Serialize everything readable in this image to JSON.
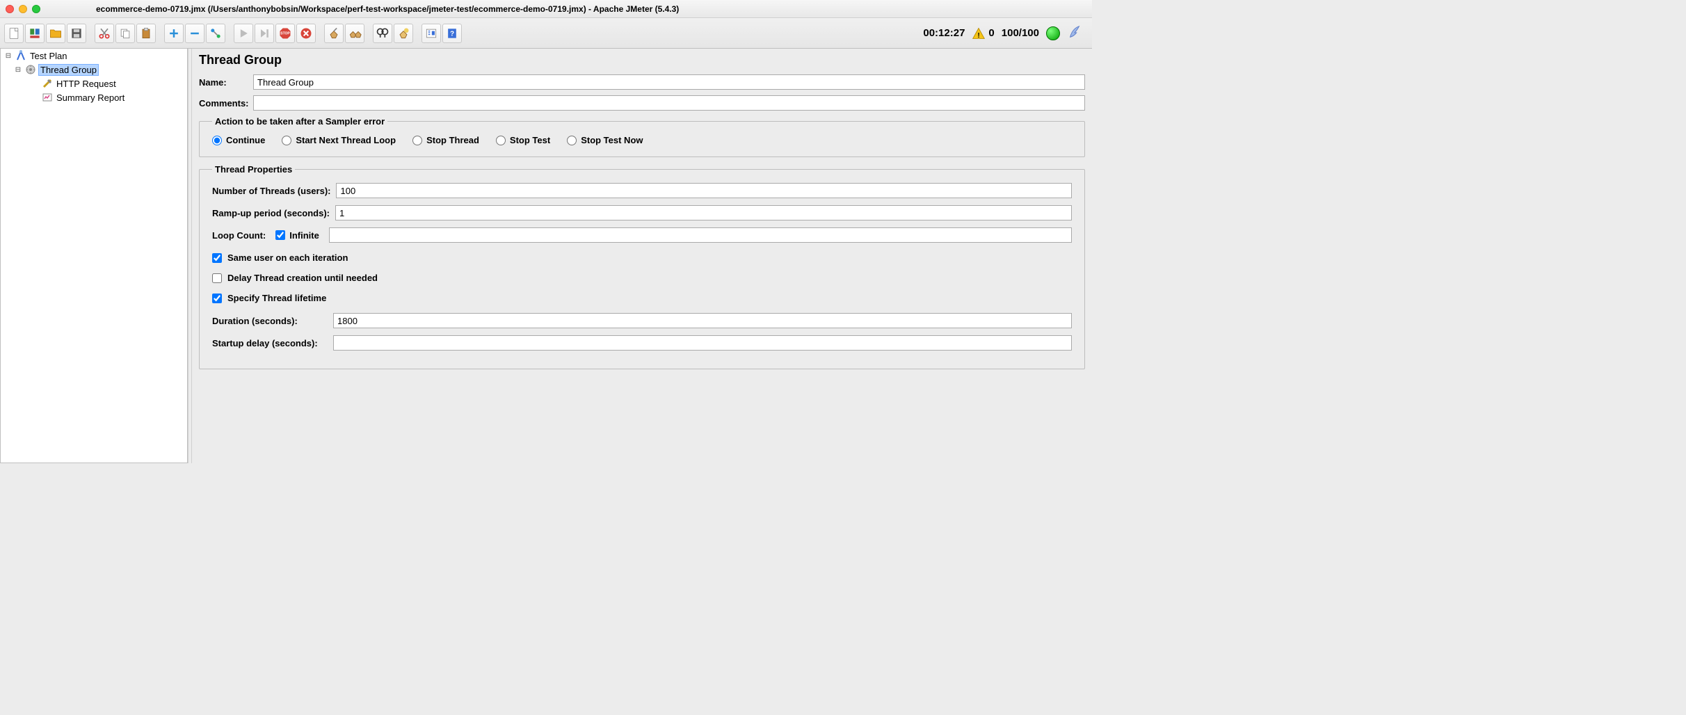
{
  "window": {
    "title": "ecommerce-demo-0719.jmx (/Users/anthonybobsin/Workspace/perf-test-workspace/jmeter-test/ecommerce-demo-0719.jmx) - Apache JMeter (5.4.3)"
  },
  "status": {
    "elapsed": "00:12:27",
    "error_count": "0",
    "thread_ratio": "100/100"
  },
  "tree": {
    "root": "Test Plan",
    "thread_group": "Thread Group",
    "http_request": "HTTP Request",
    "summary_report": "Summary Report"
  },
  "panel": {
    "heading": "Thread Group",
    "name_label": "Name:",
    "name_value": "Thread Group",
    "comments_label": "Comments:",
    "comments_value": "",
    "error_action_legend": "Action to be taken after a Sampler error",
    "error_actions": {
      "continue": "Continue",
      "start_next": "Start Next Thread Loop",
      "stop_thread": "Stop Thread",
      "stop_test": "Stop Test",
      "stop_test_now": "Stop Test Now"
    },
    "thread_props_legend": "Thread Properties",
    "num_threads_label": "Number of Threads (users):",
    "num_threads_value": "100",
    "ramp_up_label": "Ramp-up period (seconds):",
    "ramp_up_value": "1",
    "loop_count_label": "Loop Count:",
    "infinite_label": "Infinite",
    "loop_count_value": "",
    "same_user_label": "Same user on each iteration",
    "delay_creation_label": "Delay Thread creation until needed",
    "specify_lifetime_label": "Specify Thread lifetime",
    "duration_label": "Duration (seconds):",
    "duration_value": "1800",
    "startup_delay_label": "Startup delay (seconds):",
    "startup_delay_value": ""
  }
}
